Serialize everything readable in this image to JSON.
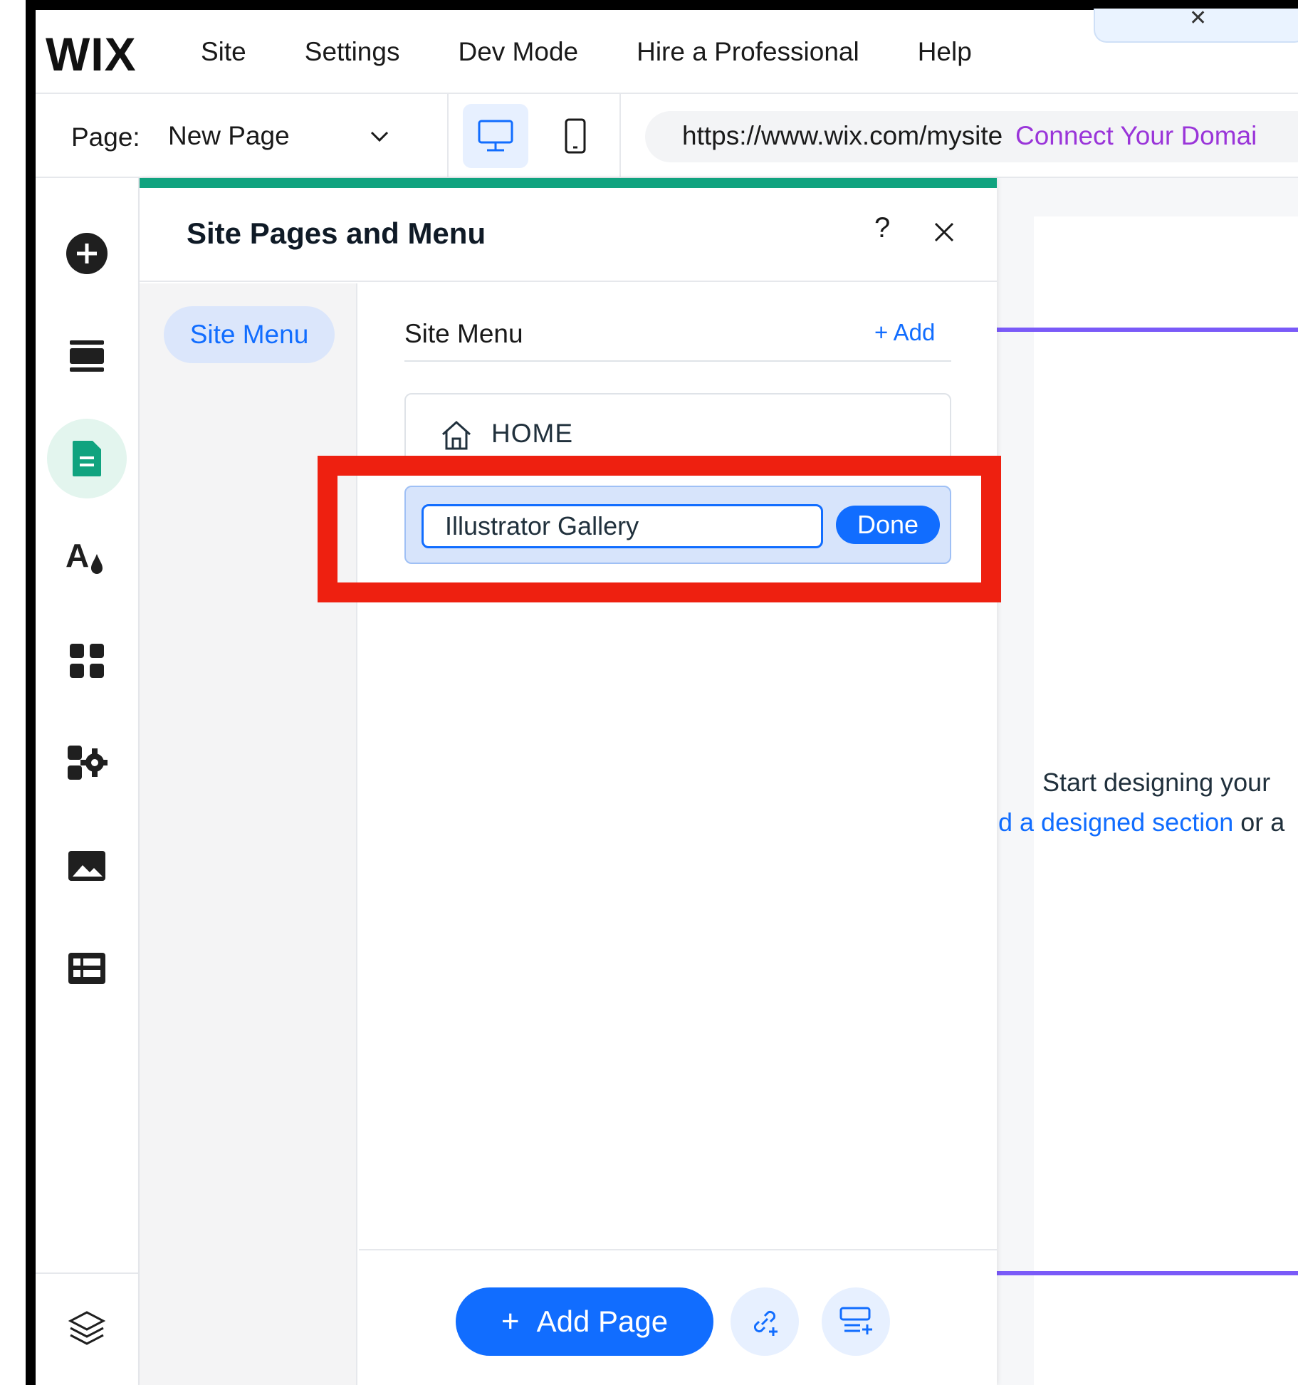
{
  "topbar": {
    "logo": "WIX",
    "menu": [
      "Site",
      "Settings",
      "Dev Mode",
      "Hire a Professional",
      "Help"
    ]
  },
  "subbar": {
    "page_label": "Page:",
    "page_value": "New Page",
    "url": "https://www.wix.com/mysite",
    "connect_domain": "Connect Your Domai"
  },
  "rail": {
    "icons": [
      "add-icon",
      "sections-icon",
      "pages-icon",
      "theme-icon",
      "apps-icon",
      "business-apps-icon",
      "media-icon",
      "cms-icon",
      "layers-icon"
    ]
  },
  "panel": {
    "title": "Site Pages and Menu",
    "help": "?",
    "left_tab": "Site Menu",
    "section_title": "Site Menu",
    "add_label": "+ Add",
    "home_label": "HOME",
    "editing_value": "Illustrator Gallery",
    "done_label": "Done",
    "add_page_label": "Add Page",
    "add_page_plus": "+"
  },
  "canvas": {
    "line1": "Start designing your",
    "line2_pre": "ld a designed section",
    "line2_post": " or a"
  },
  "colors": {
    "accent": "#116dff",
    "panel_top": "#10a37f",
    "highlight": "#ee2010",
    "domain_link": "#9a35d9",
    "canvas_line": "#7a5af8"
  }
}
